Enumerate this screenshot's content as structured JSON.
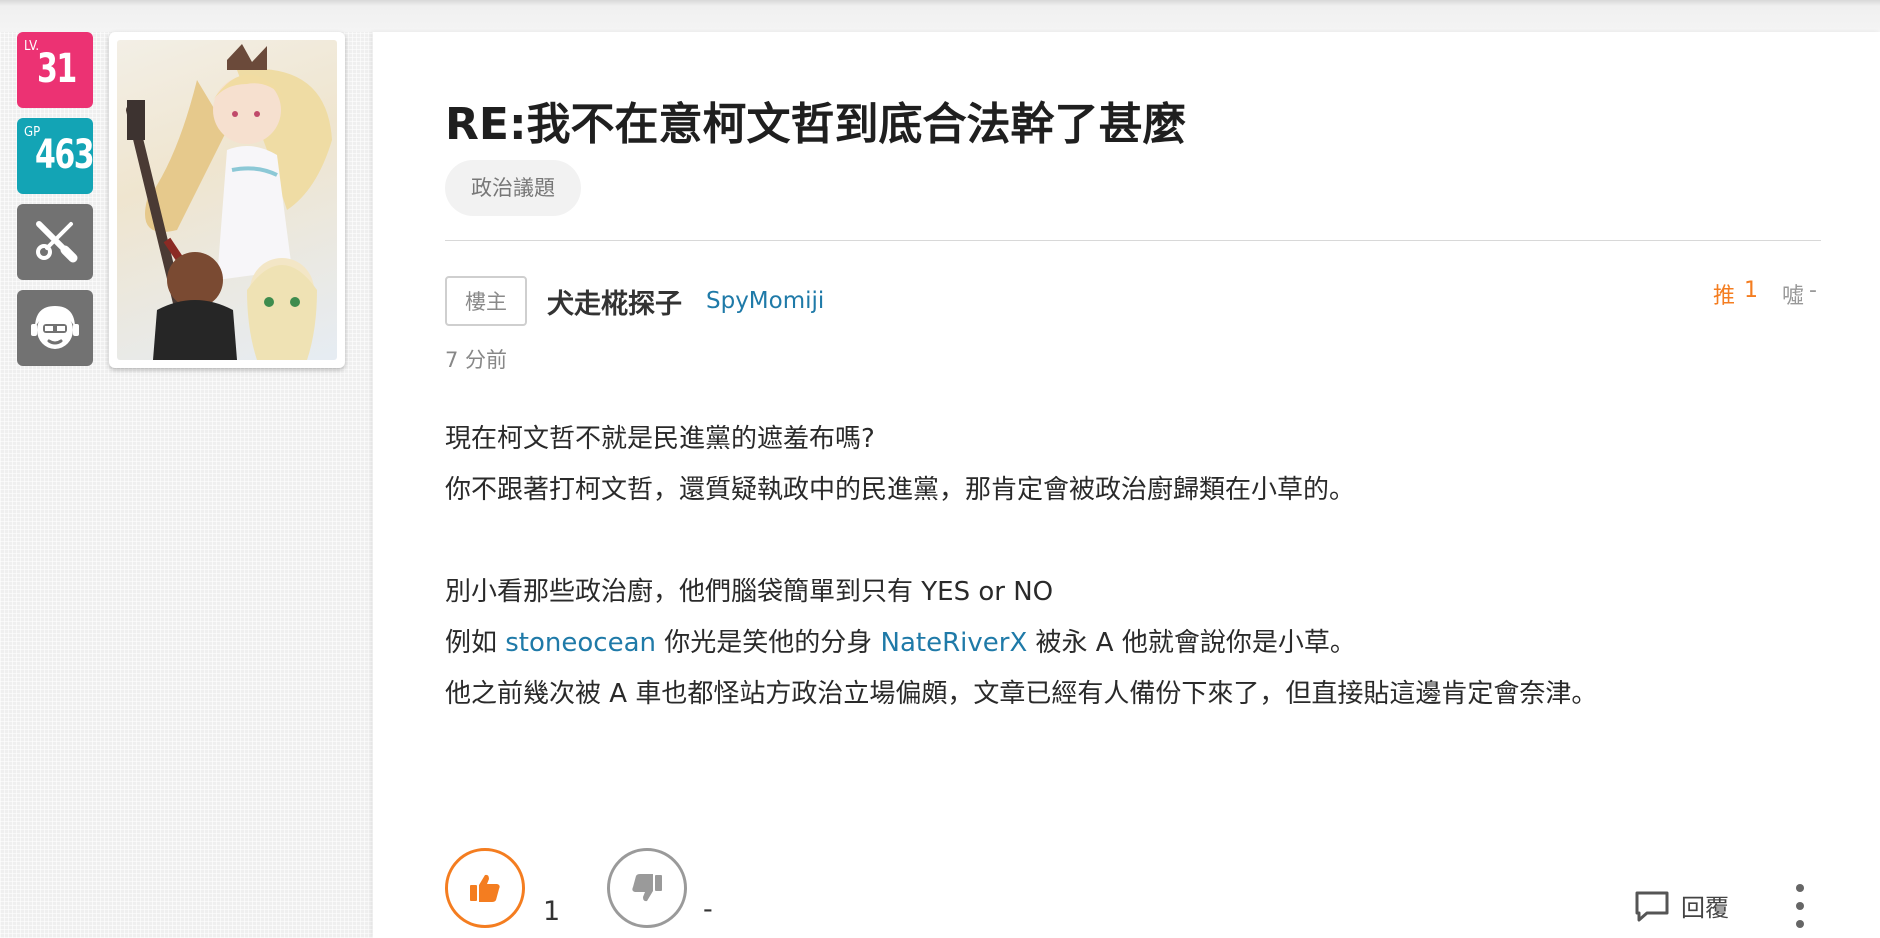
{
  "sidebar": {
    "level": {
      "tag": "LV.",
      "value": "31",
      "color": "#ec3273"
    },
    "gp": {
      "tag": "GP",
      "value": "463",
      "color": "#13a4b5"
    },
    "icons": [
      "tools-icon",
      "face-icon"
    ]
  },
  "post": {
    "title": "RE:我不在意柯文哲到底合法幹了甚麼",
    "category": "政治議題",
    "op_badge": "樓主",
    "author_name": "犬走椛探子",
    "author_id": "SpyMomiji",
    "push_label": "推",
    "push_count": "1",
    "boo_label": "噓",
    "boo_count": "-",
    "time": "7 分前",
    "lines": [
      "現在柯文哲不就是民進黨的遮羞布嗎?",
      "你不跟著打柯文哲，還質疑執政中的民進黨，那肯定會被政治廚歸類在小草的。",
      "別小看那些政治廚，他們腦袋簡單到只有 YES or NO",
      "他之前幾次被 A 車也都怪站方政治立場偏頗，文章已經有人備份下來了，但直接貼這邊肯定會奈津。"
    ],
    "mention_line": {
      "before": "例如 ",
      "user1": "stoneocean",
      "middle": " 你光是笑他的分身 ",
      "user2": "NateRiverX",
      "after": " 被永 A 他就會說你是小草。"
    }
  },
  "actions": {
    "like_count": "1",
    "dislike_count": "-",
    "reply_label": "回覆"
  },
  "colors": {
    "accent_orange": "#f47d20",
    "link_blue": "#1f7aa8"
  }
}
